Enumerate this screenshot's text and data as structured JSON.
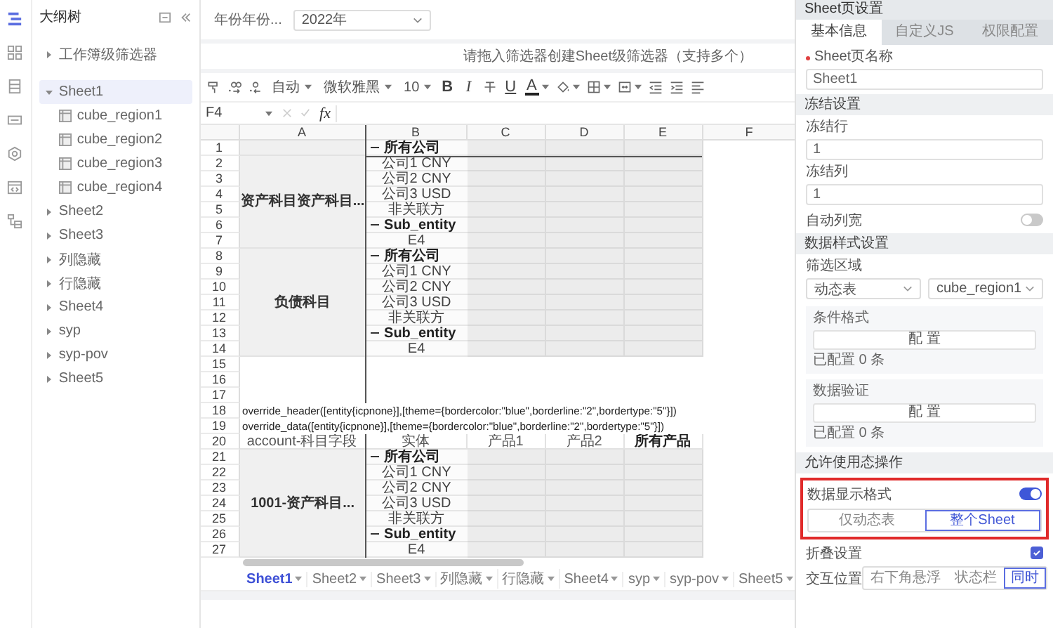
{
  "rail": [
    {
      "selected": true
    },
    {
      "selected": false
    },
    {
      "selected": false
    },
    {
      "selected": false
    },
    {
      "selected": false
    },
    {
      "selected": false
    },
    {
      "selected": false
    }
  ],
  "tree": {
    "title": "大纲树",
    "workbook": [
      {
        "label": "工作簿级筛选器",
        "expanded": false,
        "selected": false
      }
    ],
    "sheets": [
      {
        "label": "Sheet1",
        "expanded": true,
        "selected": true,
        "children": [
          {
            "label": "cube_region1"
          },
          {
            "label": "cube_region2"
          },
          {
            "label": "cube_region3"
          },
          {
            "label": "cube_region4"
          }
        ]
      },
      {
        "label": "Sheet2",
        "expanded": false,
        "selected": false
      },
      {
        "label": "Sheet3",
        "expanded": false,
        "selected": false
      },
      {
        "label": "列隐藏",
        "expanded": false,
        "selected": false
      },
      {
        "label": "行隐藏",
        "expanded": false,
        "selected": false
      },
      {
        "label": "Sheet4",
        "expanded": false,
        "selected": false
      },
      {
        "label": "syp",
        "expanded": false,
        "selected": false
      },
      {
        "label": "syp-pov",
        "expanded": false,
        "selected": false
      },
      {
        "label": "Sheet5",
        "expanded": false,
        "selected": false
      }
    ]
  },
  "filter": {
    "label": "年份年份...",
    "value": "2022年"
  },
  "drop_hint": "请拖入筛选器创建Sheet级筛选器（支持多个）",
  "toolbar": {
    "number_format": "自动",
    "font": "微软雅黑",
    "font_size": "10",
    "bold": "B",
    "italic": "I",
    "underline": "U",
    "font_color": "A"
  },
  "formula_bar": {
    "name_box": "F4",
    "function_label": "fx"
  },
  "sheet": {
    "columns": [
      "A",
      "B",
      "C",
      "D",
      "E",
      "F"
    ],
    "row_numbers": [
      "1",
      "2",
      "3",
      "4",
      "5",
      "6",
      "7",
      "8",
      "9",
      "10",
      "11",
      "12",
      "13",
      "14",
      "15",
      "16",
      "17",
      "18",
      "19",
      "20",
      "21",
      "22",
      "23",
      "24",
      "25",
      "26",
      "27"
    ],
    "bands": [
      {
        "kind": "pivot",
        "groups": [
          {
            "entities": [
              {
                "text": "所有公司",
                "kind": "total"
              }
            ]
          },
          {
            "label": "资产科目资产科目...",
            "entities": [
              {
                "text": "公司1 CNY",
                "kind": "item"
              },
              {
                "text": "公司2 CNY",
                "kind": "item"
              },
              {
                "text": "公司3 USD",
                "kind": "item"
              },
              {
                "text": "非关联方",
                "kind": "item"
              },
              {
                "text": "Sub_entity",
                "kind": "total"
              },
              {
                "text": "E4",
                "kind": "item"
              }
            ]
          },
          {
            "label": "负债科目",
            "entities": [
              {
                "text": "所有公司",
                "kind": "total"
              },
              {
                "text": "公司1 CNY",
                "kind": "item"
              },
              {
                "text": "公司2 CNY",
                "kind": "item"
              },
              {
                "text": "公司3 USD",
                "kind": "item"
              },
              {
                "text": "非关联方",
                "kind": "item"
              },
              {
                "text": "Sub_entity",
                "kind": "total"
              },
              {
                "text": "E4",
                "kind": "item"
              }
            ]
          }
        ]
      },
      {
        "kind": "empty"
      },
      {
        "kind": "empty"
      },
      {
        "kind": "empty"
      },
      {
        "kind": "note",
        "text": "override_header([entity{icpnone}],[theme={bordercolor:\"blue\",borderline:\"2\",bordertype:\"5\"}])"
      },
      {
        "kind": "note",
        "text": "override_data([entity{icpnone}],[theme={bordercolor:\"blue\",borderline:\"2\",bordertype:\"5\"}])"
      },
      {
        "kind": "pivot",
        "header": [
          {
            "text": "account-科目字段",
            "kind": "item"
          },
          {
            "text": "实体",
            "kind": "item"
          },
          {
            "text": "产品1",
            "kind": "item"
          },
          {
            "text": "产品2",
            "kind": "item"
          },
          {
            "text": "所有产品",
            "kind": "total"
          }
        ],
        "groups": [
          {
            "label": "1001-资产科目...",
            "entities": [
              {
                "text": "所有公司",
                "kind": "total"
              },
              {
                "text": "公司1 CNY",
                "kind": "item"
              },
              {
                "text": "公司2 CNY",
                "kind": "item"
              },
              {
                "text": "公司3 USD",
                "kind": "item"
              },
              {
                "text": "非关联方",
                "kind": "item"
              },
              {
                "text": "Sub_entity",
                "kind": "total"
              },
              {
                "text": "E4",
                "kind": "item"
              }
            ]
          }
        ]
      }
    ]
  },
  "sheet_tabs": [
    {
      "label": "Sheet1",
      "selected": true
    },
    {
      "label": "Sheet2",
      "selected": false
    },
    {
      "label": "Sheet3",
      "selected": false
    },
    {
      "label": "列隐藏",
      "selected": false
    },
    {
      "label": "行隐藏",
      "selected": false
    },
    {
      "label": "Sheet4",
      "selected": false
    },
    {
      "label": "syp",
      "selected": false
    },
    {
      "label": "syp-pov",
      "selected": false
    },
    {
      "label": "Sheet5",
      "selected": false
    }
  ],
  "settings": {
    "title": "Sheet页设置",
    "tabs": [
      {
        "label": "基本信息",
        "selected": true
      },
      {
        "label": "自定义JS",
        "selected": false
      },
      {
        "label": "权限配置",
        "selected": false
      }
    ],
    "name_field": {
      "label": "Sheet页名称",
      "required": true,
      "value": "Sheet1"
    },
    "freeze": {
      "title": "冻结设置",
      "row": {
        "label": "冻结行",
        "value": "1"
      },
      "column": {
        "label": "冻结列",
        "value": "1"
      },
      "auto_width": {
        "label": "自动列宽",
        "on": false
      }
    },
    "data_style": {
      "title": "数据样式设置",
      "filter_area": {
        "label": "筛选区域",
        "type": "动态表",
        "region": "cube_region1"
      },
      "cards": [
        {
          "title": "条件格式",
          "button": "配 置",
          "summary": "已配置 0 条"
        },
        {
          "title": "数据验证",
          "button": "配 置",
          "summary": "已配置 0 条"
        }
      ]
    },
    "runtime": {
      "title": "允许使用态操作",
      "display_format": {
        "label": "数据显示格式",
        "on": true,
        "highlighted": true,
        "options": [
          {
            "label": "仅动态表",
            "selected": false
          },
          {
            "label": "整个Sheet",
            "selected": true
          }
        ]
      },
      "fold": {
        "label": "折叠设置",
        "checked": true
      },
      "interaction": {
        "label": "交互位置",
        "options": [
          {
            "label": "右下角悬浮",
            "selected": false
          },
          {
            "label": "状态栏",
            "selected": false
          },
          {
            "label": "同时",
            "selected": true
          }
        ]
      }
    }
  }
}
